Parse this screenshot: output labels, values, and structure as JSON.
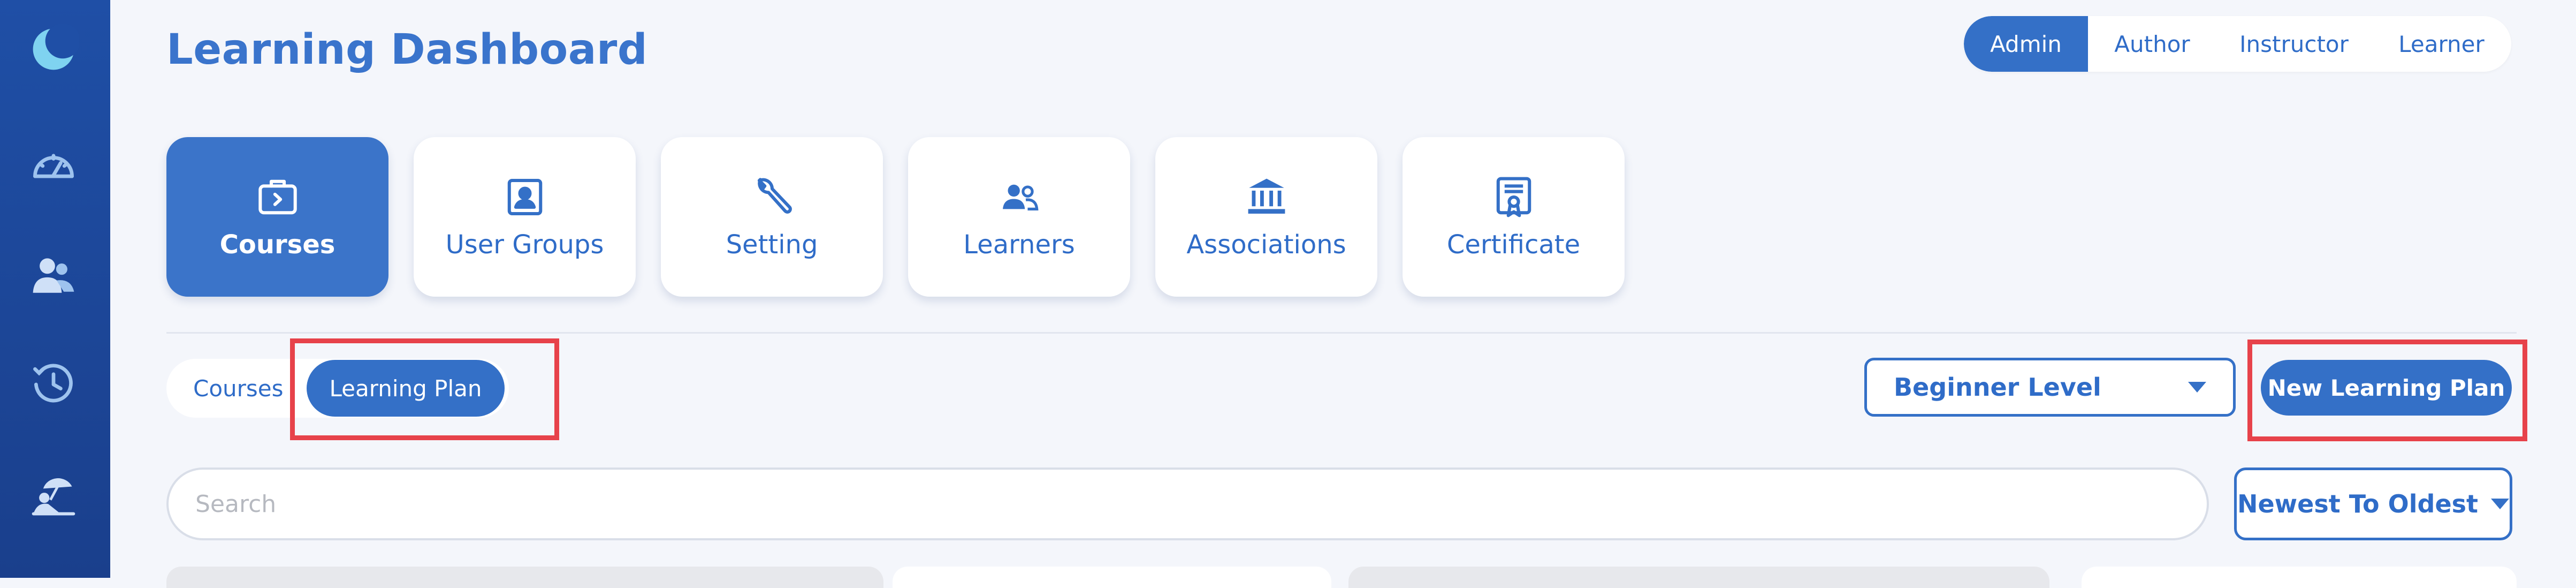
{
  "header": {
    "title": "Learning Dashboard"
  },
  "roles": [
    {
      "label": "Admin",
      "active": true
    },
    {
      "label": "Author",
      "active": false
    },
    {
      "label": "Instructor",
      "active": false
    },
    {
      "label": "Learner",
      "active": false
    }
  ],
  "sidebar": {
    "icons": [
      "moon-logo-icon",
      "dashboard-gauge-icon",
      "users-icon",
      "history-clock-icon",
      "umbrella-user-icon"
    ]
  },
  "tiles": [
    {
      "label": "Courses",
      "icon": "briefcase-arrow-icon",
      "active": true
    },
    {
      "label": "User Groups",
      "icon": "user-card-icon",
      "active": false
    },
    {
      "label": "Setting",
      "icon": "wrench-icon",
      "active": false
    },
    {
      "label": "Learners",
      "icon": "two-users-icon",
      "active": false
    },
    {
      "label": "Associations",
      "icon": "institution-icon",
      "active": false
    },
    {
      "label": "Certificate",
      "icon": "certificate-icon",
      "active": false
    }
  ],
  "subtabs": [
    {
      "label": "Courses",
      "active": false
    },
    {
      "label": "Learning Plan",
      "active": true
    }
  ],
  "level_select": {
    "value": "Beginner Level"
  },
  "new_button": {
    "label": "New Learning Plan"
  },
  "search": {
    "placeholder": "Search",
    "value": ""
  },
  "sort": {
    "value": "Newest To Oldest"
  },
  "colors": {
    "primary": "#3470c7",
    "sidebar": "#1f4fa6",
    "highlight": "#e7424a",
    "background": "#f4f6fb"
  }
}
